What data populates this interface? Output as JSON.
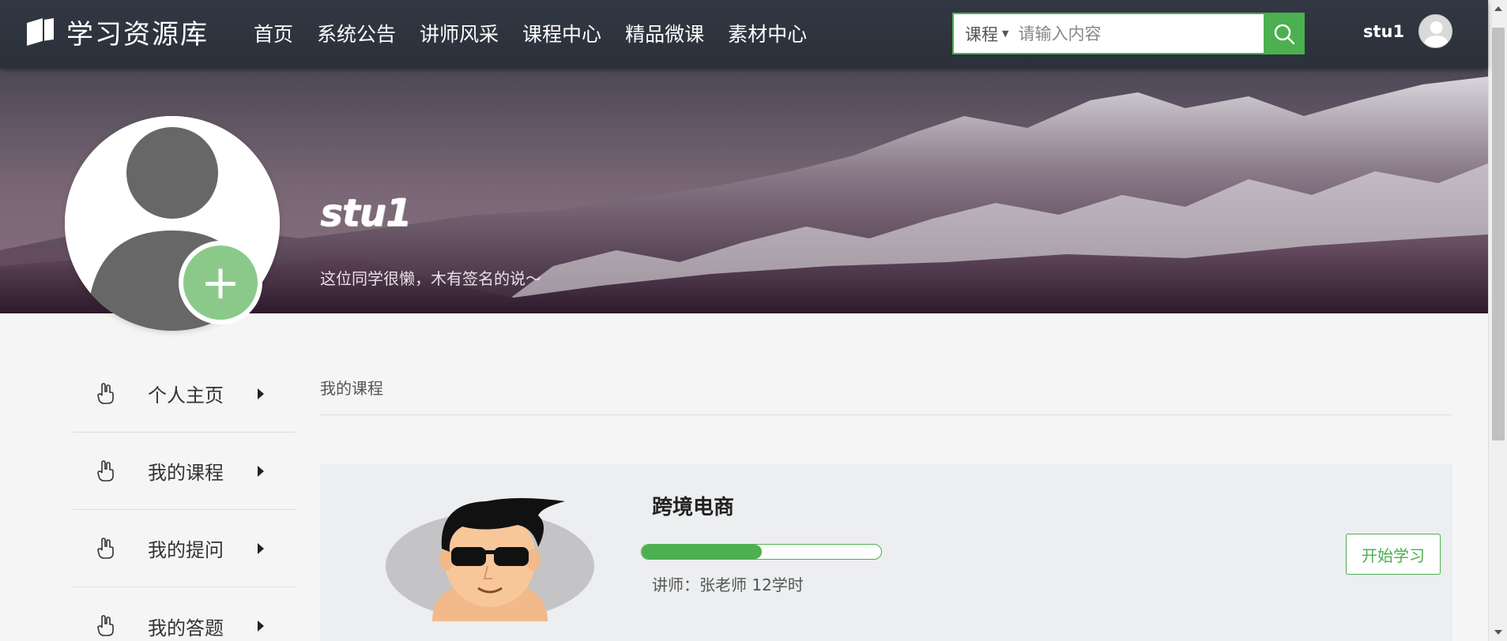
{
  "app": {
    "logo_text": "学习资源库"
  },
  "nav": {
    "items": [
      {
        "label": "首页"
      },
      {
        "label": "系统公告"
      },
      {
        "label": "讲师风采"
      },
      {
        "label": "课程中心"
      },
      {
        "label": "精品微课"
      },
      {
        "label": "素材中心"
      }
    ]
  },
  "search": {
    "category": "课程",
    "placeholder": "请输入内容",
    "value": ""
  },
  "user": {
    "name": "stu1"
  },
  "profile": {
    "name": "stu1",
    "signature": "这位同学很懒，木有签名的说～",
    "add_symbol": "+"
  },
  "sidebar": {
    "items": [
      {
        "label": "个人主页"
      },
      {
        "label": "我的课程"
      },
      {
        "label": "我的提问"
      },
      {
        "label": "我的答题"
      }
    ]
  },
  "main": {
    "section_title": "我的课程",
    "courses": [
      {
        "title": "跨境电商",
        "progress": 0.5,
        "meta": "讲师：张老师  12学时",
        "action": "开始学习"
      }
    ]
  },
  "colors": {
    "accent": "#4caf50",
    "header_bg": "#2f3440",
    "page_bg": "#f5f5f6",
    "card_bg": "#eceef0"
  }
}
